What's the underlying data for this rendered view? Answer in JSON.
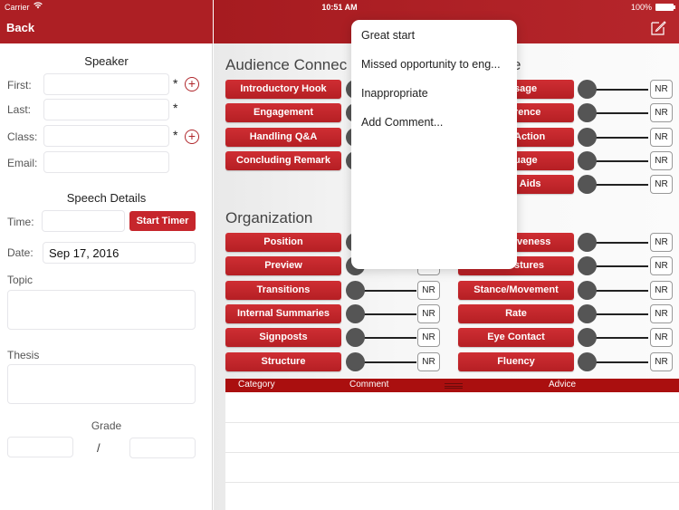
{
  "status_bar": {
    "carrier": "Carrier",
    "wifi_icon": "wifi-icon",
    "time": "10:51 AM",
    "battery": "100%"
  },
  "left_panel": {
    "back_label": "Back",
    "speaker_title": "Speaker",
    "fields": {
      "first": {
        "label": "First:",
        "value": "",
        "required": "*"
      },
      "last": {
        "label": "Last:",
        "value": "",
        "required": "*"
      },
      "class": {
        "label": "Class:",
        "value": "",
        "required": "*"
      },
      "email": {
        "label": "Email:",
        "value": ""
      }
    },
    "speech_details_title": "Speech Details",
    "time_label": "Time:",
    "time_value": "",
    "start_timer_label": "Start Timer",
    "date_label": "Date:",
    "date_value": "Sep 17, 2016",
    "topic_label": "Topic",
    "topic_value": "",
    "thesis_label": "Thesis",
    "thesis_value": "",
    "grade_label": "Grade",
    "grade_score": "",
    "grade_separator": "/",
    "grade_total": ""
  },
  "main": {
    "sections": [
      {
        "title": "Audience Connec",
        "left_items": [
          "Introductory Hook",
          "Engagement",
          "Handling Q&A",
          "Concluding Remark"
        ],
        "right_items": [
          "sage",
          "rence",
          "Action",
          "uage",
          "l Aids"
        ]
      },
      {
        "title": "Organization",
        "left_items": [
          "Position",
          "Preview",
          "Transitions",
          "Internal Summaries",
          "Signposts",
          "Structure"
        ],
        "right_items": [
          "iveness",
          "stures",
          "Stance/Movement",
          "Rate",
          "Eye Contact",
          "Fluency"
        ]
      }
    ],
    "section1_title_right_fragment": "e",
    "rating_label": "NR",
    "table": {
      "headers": [
        "Category",
        "Comment",
        "Advice"
      ],
      "rows": []
    }
  },
  "popover": {
    "items": [
      "Great start",
      "Missed opportunity to eng...",
      "Inappropriate",
      "Add Comment..."
    ]
  }
}
